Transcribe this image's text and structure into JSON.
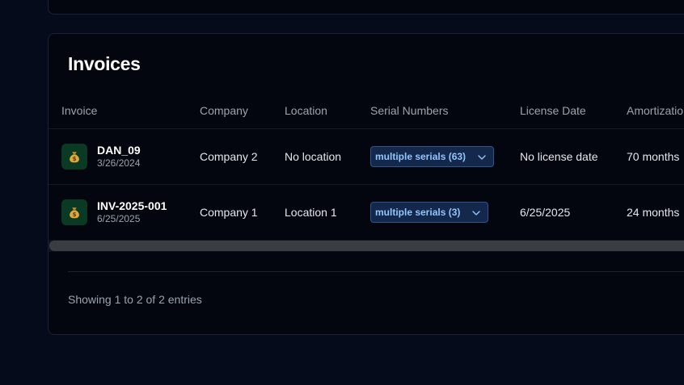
{
  "card": {
    "title": "Invoices"
  },
  "table": {
    "headers": {
      "invoice": "Invoice",
      "company": "Company",
      "location": "Location",
      "serial_numbers": "Serial Numbers",
      "license_date": "License Date",
      "amortization": "Amortizatio"
    },
    "rows": [
      {
        "icon": "money-bag-icon",
        "invoice_name": "DAN_09",
        "invoice_date": "3/26/2024",
        "company": "Company 2",
        "location": "No location",
        "serial_numbers": "multiple serials (63)",
        "license_date": "No license date",
        "amortization": "70 months"
      },
      {
        "icon": "money-bag-icon",
        "invoice_name": "INV-2025-001",
        "invoice_date": "6/25/2025",
        "company": "Company 1",
        "location": "Location 1",
        "serial_numbers": "multiple serials (3)",
        "license_date": "6/25/2025",
        "amortization": "24 months"
      }
    ]
  },
  "footer": {
    "entries_text": "Showing 1 to 2 of 2 entries"
  },
  "colors": {
    "background": "#050b1a",
    "card": "#03060f",
    "select_bg": "#13284a",
    "select_border": "#2a5590",
    "select_text": "#93c5fd",
    "icon_bg": "#0b3a24"
  }
}
